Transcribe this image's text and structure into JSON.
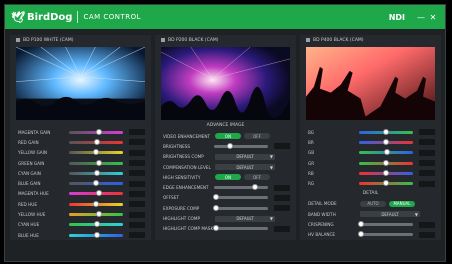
{
  "app": {
    "brand": "BirdDog",
    "title": "CAM CONTROL",
    "ndi": "NDI",
    "minimize": "—",
    "close": "✕"
  },
  "panels": [
    {
      "name": "BD P100 WHITE (CAM)",
      "color_rows": [
        {
          "label": "MAGENTA GAIN",
          "value": "",
          "pos": 0.55,
          "gradient": "linear-gradient(90deg,#555,#d63dd6)"
        },
        {
          "label": "RED GAIN",
          "value": "",
          "pos": 0.52,
          "gradient": "linear-gradient(90deg,#555,#e33)"
        },
        {
          "label": "YELLOW GAIN",
          "value": "",
          "pos": 0.5,
          "gradient": "linear-gradient(90deg,#555,#e8d623)"
        },
        {
          "label": "GREEN GAIN",
          "value": "",
          "pos": 0.55,
          "gradient": "linear-gradient(90deg,#555,#33c24a)"
        },
        {
          "label": "CYAN GAIN",
          "value": "",
          "pos": 0.52,
          "gradient": "linear-gradient(90deg,#555,#2fd0d8)"
        },
        {
          "label": "BLUE GAIN",
          "value": "",
          "pos": 0.5,
          "gradient": "linear-gradient(90deg,#555,#2e61e6)"
        },
        {
          "label": "MAGENTA HUE",
          "value": "",
          "pos": 0.55,
          "gradient": "linear-gradient(90deg,#d63dd6,#e33)"
        },
        {
          "label": "RED HUE",
          "value": "",
          "pos": 0.5,
          "gradient": "linear-gradient(90deg,#e33,#e8d623)"
        },
        {
          "label": "YELLOW HUE",
          "value": "",
          "pos": 0.55,
          "gradient": "linear-gradient(90deg,#e8a023,#33c24a)"
        },
        {
          "label": "CYAN HUE",
          "value": "",
          "pos": 0.52,
          "gradient": "linear-gradient(90deg,#33c24a,#2fd0d8)"
        },
        {
          "label": "BLUE HUE",
          "value": "",
          "pos": 0.52,
          "gradient": "linear-gradient(90deg,#2fd0d8,#2e61e6)"
        }
      ]
    },
    {
      "name": "BD P200 BLACK (CAM)",
      "section": "ADVANCE IMAGE",
      "rows": [
        {
          "label": "VIDEO ENHANCEMENT",
          "type": "toggle",
          "on": "ON",
          "off": "OFF"
        },
        {
          "label": "BRIGHTNESS",
          "type": "slider",
          "pos": 0.3
        },
        {
          "label": "BRIGHTNESS COMP",
          "type": "dropdown",
          "value": "DEFAULT"
        },
        {
          "label": "COMPENSATION LEVEL",
          "type": "dropdown",
          "value": "DEFAULT"
        },
        {
          "label": "HIGH SENSITIVITY",
          "type": "toggle",
          "on": "ON",
          "off": "OFF"
        },
        {
          "label": "EDGE ENHANCEMENT",
          "type": "slider",
          "pos": 0.75
        },
        {
          "label": "OFFSET",
          "type": "slider",
          "pos": 0.05
        },
        {
          "label": "EXPOSURE COMP",
          "type": "slider",
          "pos": 0.05
        },
        {
          "label": "HIGHLIGHT COMP",
          "type": "dropdown",
          "value": "DEFAULT"
        },
        {
          "label": "HIGHLIGHT COMP MASK",
          "type": "slider",
          "pos": 0.05
        }
      ]
    },
    {
      "name": "BD P400 BLACK (CAM)",
      "color_rows": [
        {
          "label": "BG",
          "value": "",
          "pos": 0.5,
          "gradient": "linear-gradient(90deg,#2e61e6,#33c24a)"
        },
        {
          "label": "BR",
          "value": "",
          "pos": 0.5,
          "gradient": "linear-gradient(90deg,#2e61e6,#e33)"
        },
        {
          "label": "GB",
          "value": "",
          "pos": 0.52,
          "gradient": "linear-gradient(90deg,#33c24a,#2e61e6)"
        },
        {
          "label": "GR",
          "value": "",
          "pos": 0.5,
          "gradient": "linear-gradient(90deg,#33c24a,#e33)"
        },
        {
          "label": "RB",
          "value": "",
          "pos": 0.5,
          "gradient": "linear-gradient(90deg,#e33,#2e61e6)"
        },
        {
          "label": "RG",
          "value": "",
          "pos": 0.5,
          "gradient": "linear-gradient(90deg,#e33,#33c24a)"
        }
      ],
      "section": "DETAIL",
      "rows": [
        {
          "label": "DETAIL MODE",
          "type": "toggle",
          "on": "AUTO",
          "off": "MANUAL",
          "active": "off"
        },
        {
          "label": "BAND WIDTH",
          "type": "dropdown",
          "value": "DEFAULT"
        },
        {
          "label": "CRISPENING",
          "type": "slider",
          "pos": 0.05
        },
        {
          "label": "HV BALANCE",
          "type": "slider",
          "pos": 0.05
        }
      ]
    }
  ],
  "colors": {
    "accent": "#1ea84a",
    "window": "#1f2225",
    "panel": "#25292d"
  }
}
